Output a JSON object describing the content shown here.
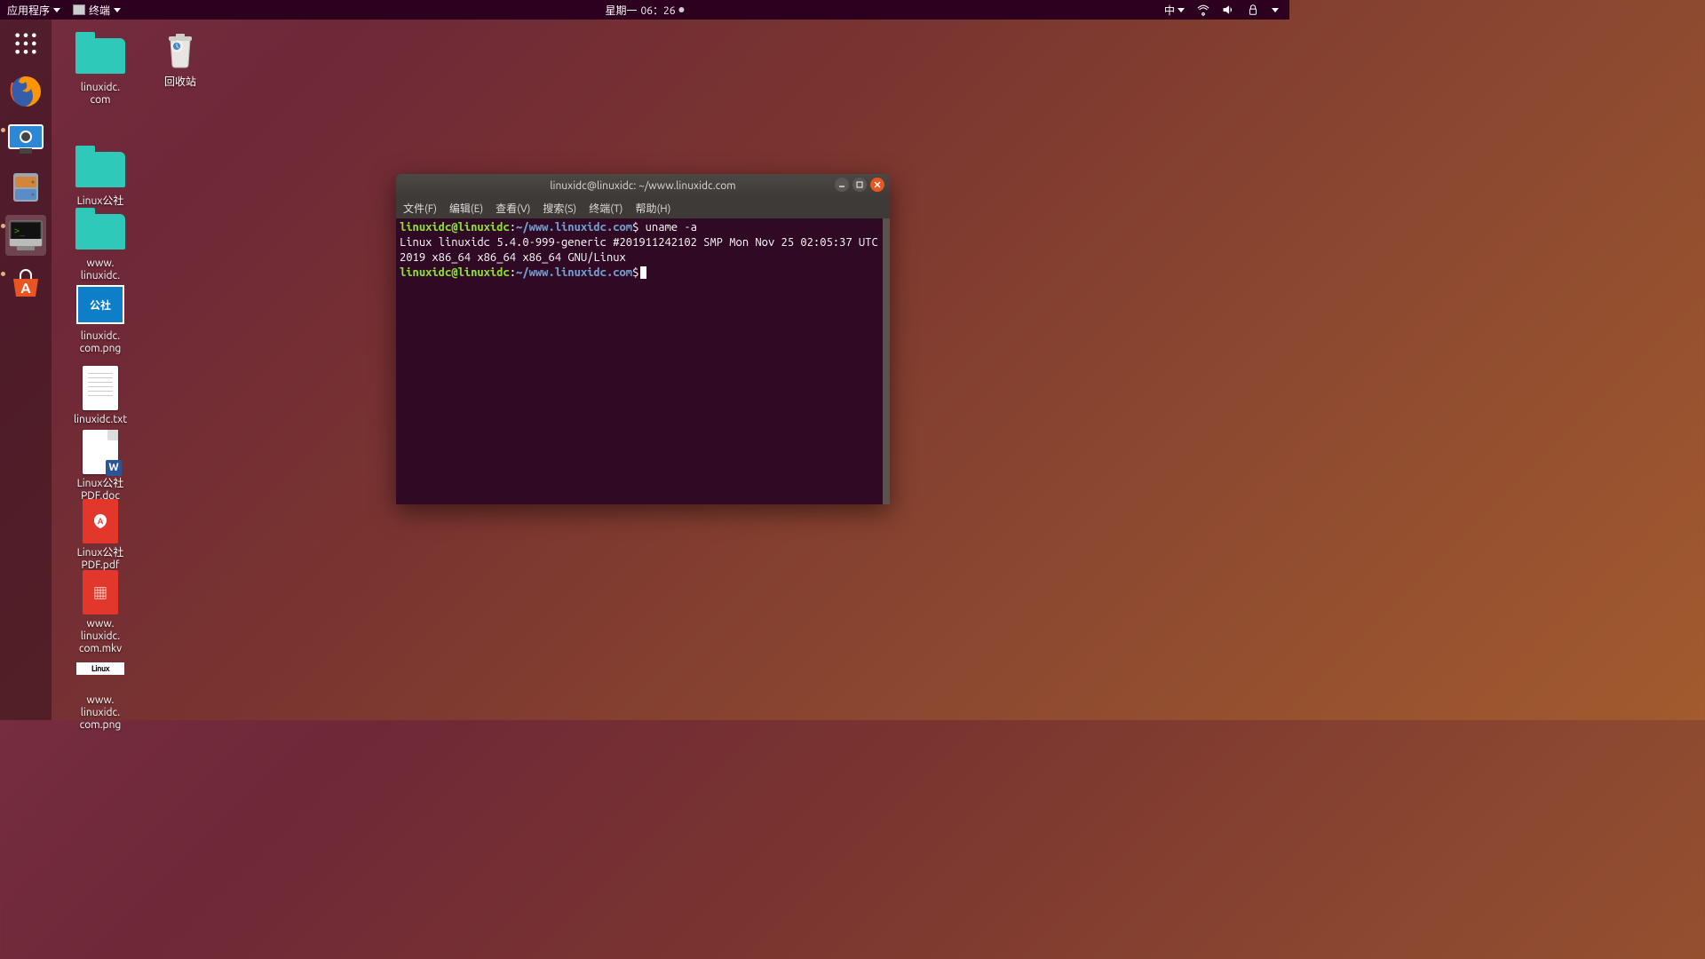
{
  "panel": {
    "apps_label": "应用程序",
    "active_app_label": "终端",
    "clock_day": "星期一",
    "clock_time": "06：26",
    "ime": "中"
  },
  "launcher": {
    "items": [
      {
        "name": "apps-grid",
        "type": "grid"
      },
      {
        "name": "firefox",
        "type": "firefox"
      },
      {
        "name": "screenshot",
        "type": "screenshot"
      },
      {
        "name": "files",
        "type": "files"
      },
      {
        "name": "terminal",
        "type": "terminal",
        "active": true
      },
      {
        "name": "software",
        "type": "software"
      }
    ]
  },
  "desktop_icons": {
    "trash_label": "回收站",
    "items": [
      {
        "label": "linuxidc.\ncom",
        "type": "folder"
      },
      {
        "label": "Linux公社",
        "type": "folder"
      },
      {
        "label": "www.\nlinuxidc.\ncom",
        "type": "folder"
      },
      {
        "label": "linuxidc.\ncom.png",
        "type": "img",
        "thumb": "公社"
      },
      {
        "label": "linuxidc.txt",
        "type": "txt"
      },
      {
        "label": "Linux公社\nPDF.doc",
        "type": "doc"
      },
      {
        "label": "Linux公社\nPDF.pdf",
        "type": "pdf"
      },
      {
        "label": "www.\nlinuxidc.\ncom.mkv",
        "type": "mkv"
      },
      {
        "label": "www.\nlinuxidc.\ncom.png",
        "type": "png2",
        "thumb": "Linux"
      }
    ]
  },
  "terminal": {
    "title": "linuxidc@linuxidc: ~/www.linuxidc.com",
    "menus": [
      "文件(F)",
      "编辑(E)",
      "查看(V)",
      "搜索(S)",
      "终端(T)",
      "帮助(H)"
    ],
    "prompt_user": "linuxidc@linuxidc",
    "prompt_path": "~/www.linuxidc.com",
    "cmd1": "uname -a",
    "output1": "Linux linuxidc 5.4.0-999-generic #201911242102 SMP Mon Nov 25 02:05:37 UTC 2019 x86_64 x86_64 x86_64 GNU/Linux"
  }
}
